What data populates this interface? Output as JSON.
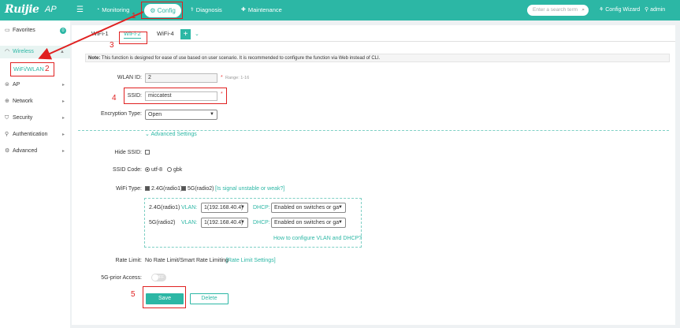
{
  "header": {
    "logo_text": "Ruijie",
    "logo_ap": "AP",
    "nav": [
      "Monitoring",
      "Config",
      "Diagnosis",
      "Maintenance"
    ],
    "search_placeholder": "Enter a search term",
    "config_wizard": "Config Wizard",
    "user": "admin"
  },
  "sidebar": {
    "favorites": "Favorites",
    "favorites_count": "0",
    "items": [
      "Wireless",
      "AP",
      "Network",
      "Security",
      "Authentication",
      "Advanced"
    ],
    "sub_item": "WiFi/WLAN"
  },
  "tabs": [
    "WiFi-1",
    "WiFi-2",
    "WiFi-4"
  ],
  "note_label": "Note:",
  "note_text": "This function is designed for ease of use based on user scenario. It is recommended to configure the function via Web instead of CLI.",
  "form": {
    "wlan_id_label": "WLAN ID:",
    "wlan_id_value": "2",
    "wlan_id_hint": "Range: 1-16",
    "ssid_label": "SSID:",
    "ssid_value": "miccatest",
    "encryption_label": "Encryption Type:",
    "encryption_value": "Open",
    "advanced": "Advanced Settings",
    "hide_ssid_label": "Hide SSID:",
    "ssid_code_label": "SSID Code:",
    "ssid_code_opt1": "utf-8",
    "ssid_code_opt2": "gbk",
    "wifi_type_label": "WiFi Type:",
    "wifi_type_opt1": "2.4G(radio1)",
    "wifi_type_opt2": "5G(radio2)",
    "signal_link": "[Is signal unstable or weak?]",
    "radio1_label": "2.4G(radio1)",
    "radio2_label": "5G(radio2)",
    "vlan_label": "VLAN:",
    "dhcp_label": "DHCP:",
    "vlan_value": "1(192.168.40.4)",
    "dhcp_value": "Enabled on switches or ga",
    "vlan_help": "How to configure VLAN and DHCP?",
    "rate_limit_label": "Rate Limit:",
    "rate_limit_value": "No Rate Limit/Smart Rate Limiting",
    "rate_limit_link": "[Rate Limit Settings]",
    "prior_label": "5G-prior Access:",
    "prior_value": "OFF",
    "save": "Save",
    "delete": "Delete"
  },
  "annotations": [
    "1",
    "2",
    "3",
    "4",
    "5"
  ],
  "colors": {
    "accent": "#2cb7a5",
    "annotation": "#e02020"
  }
}
